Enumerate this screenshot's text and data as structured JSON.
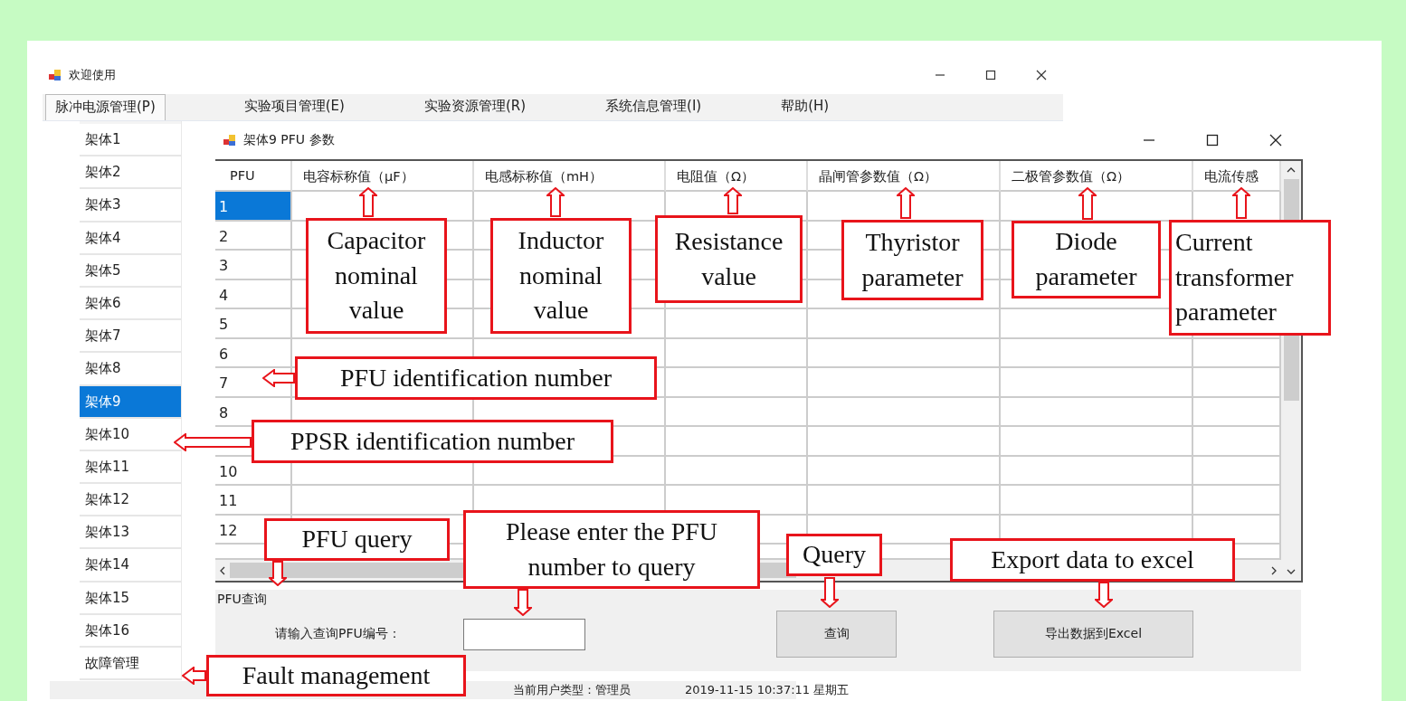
{
  "window": {
    "title": "欢迎使用"
  },
  "menu": [
    {
      "label": "脉冲电源管理(P)",
      "selected": true
    },
    {
      "label": "实验项目管理(E)",
      "selected": false
    },
    {
      "label": "实验资源管理(R)",
      "selected": false
    },
    {
      "label": "系统信息管理(I)",
      "selected": false
    },
    {
      "label": "帮助(H)",
      "selected": false
    }
  ],
  "sidebar": {
    "items": [
      {
        "label": "架体1",
        "selected": false
      },
      {
        "label": "架体2",
        "selected": false
      },
      {
        "label": "架体3",
        "selected": false
      },
      {
        "label": "架体4",
        "selected": false
      },
      {
        "label": "架体5",
        "selected": false
      },
      {
        "label": "架体6",
        "selected": false
      },
      {
        "label": "架体7",
        "selected": false
      },
      {
        "label": "架体8",
        "selected": false
      },
      {
        "label": "架体9",
        "selected": true
      },
      {
        "label": "架体10",
        "selected": false
      },
      {
        "label": "架体11",
        "selected": false
      },
      {
        "label": "架体12",
        "selected": false
      },
      {
        "label": "架体13",
        "selected": false
      },
      {
        "label": "架体14",
        "selected": false
      },
      {
        "label": "架体15",
        "selected": false
      },
      {
        "label": "架体16",
        "selected": false
      },
      {
        "label": "故障管理",
        "selected": false
      }
    ]
  },
  "child_window": {
    "title": "架体9 PFU 参数",
    "table": {
      "columns": [
        "PFU",
        "电容标称值（μF）",
        "电感标称值（mH）",
        "电阻值（Ω）",
        "晶闸管参数值（Ω）",
        "二极管参数值（Ω）",
        "电流传感"
      ],
      "rows": [
        {
          "pfu": "1",
          "selected": true
        },
        {
          "pfu": "2",
          "selected": false
        },
        {
          "pfu": "3",
          "selected": false
        },
        {
          "pfu": "4",
          "selected": false
        },
        {
          "pfu": "5",
          "selected": false
        },
        {
          "pfu": "6",
          "selected": false
        },
        {
          "pfu": "7",
          "selected": false
        },
        {
          "pfu": "8",
          "selected": false
        },
        {
          "selected": false
        },
        {
          "pfu": "10",
          "selected": false
        },
        {
          "pfu": "11",
          "selected": false
        },
        {
          "pfu": "12",
          "selected": false
        }
      ]
    },
    "query_group": {
      "title": "PFU查询",
      "field_label": "请输入查询PFU编号：",
      "query_button": "查询",
      "export_button": "导出数据到Excel"
    }
  },
  "status_bar": {
    "user_type": "当前用户类型：管理员",
    "datetime": "2019-11-15 10:37:11  星期五"
  },
  "annotations": [
    {
      "text": "Capacitor nominal value",
      "kind": "up"
    },
    {
      "text": "Inductor nominal value",
      "kind": "up"
    },
    {
      "text": "Resistance value",
      "kind": "up"
    },
    {
      "text": "Thyristor parameter",
      "kind": "up"
    },
    {
      "text": "Diode parameter",
      "kind": "up"
    },
    {
      "text": "Current transformer parameter",
      "kind": "up"
    },
    {
      "text": "PFU identification number",
      "kind": "left"
    },
    {
      "text": "PPSR identification number",
      "kind": "left"
    },
    {
      "text": "PFU query",
      "kind": "down"
    },
    {
      "text": "Please enter the PFU number to query",
      "kind": "down"
    },
    {
      "text": "Query",
      "kind": "down"
    },
    {
      "text": "Export data to excel",
      "kind": "down"
    },
    {
      "text": "Fault management",
      "kind": "left"
    }
  ]
}
